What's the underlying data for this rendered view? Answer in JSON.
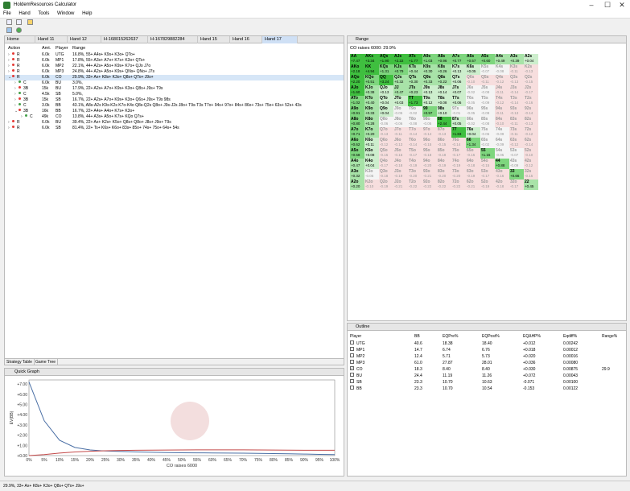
{
  "window": {
    "title": "HoldemResources Calculator"
  },
  "menu": [
    "File",
    "Hand",
    "Tools",
    "Window",
    "Help"
  ],
  "tabs": [
    "Home",
    "Hand 11",
    "Hand 12",
    "H-168015262637",
    "H-167829882284",
    "Hand 15",
    "Hand 16",
    "Hand 17"
  ],
  "strategy": {
    "headers": {
      "action": "Action",
      "amt": "Amt.",
      "player": "Player",
      "range": "Range"
    },
    "rows": [
      {
        "indent": 0,
        "expander": "›",
        "act": "R",
        "amt": "6.0k",
        "player": "UTG",
        "range": "16.8%, 55+ A4s+ K9s+ K3o+ QTo+",
        "color": "#e53935",
        "sel": false
      },
      {
        "indent": 0,
        "expander": "›",
        "act": "R",
        "amt": "6.0k",
        "player": "MP1",
        "range": "17.8%, 55+ A3s+ A7o+ K7s+ K3o+ QTs+",
        "color": "#e53935",
        "sel": false
      },
      {
        "indent": 0,
        "expander": "›",
        "act": "R",
        "amt": "6.0k",
        "player": "MP2",
        "range": "22.1%, 44+ A2s+ A5o+ K9s+ K7o+ QJo J7o",
        "color": "#e53935",
        "sel": false
      },
      {
        "indent": 0,
        "expander": "›",
        "act": "R",
        "amt": "6.0k",
        "player": "MP3",
        "range": "24.8%, 44+ A2s+ A5o+ K9s+ QNs+ QNo+ J7s",
        "color": "#e53935",
        "sel": false
      },
      {
        "indent": 0,
        "expander": "⌄",
        "act": "R",
        "amt": "6.0k",
        "player": "CO",
        "range": "29.9%, 33+ Ax+ K8s+ K3o+ Q8s+ QTo+ J9s+",
        "color": "#e53935",
        "sel": true
      },
      {
        "indent": 1,
        "expander": "›",
        "act": "C",
        "amt": "6.0k",
        "player": "BU",
        "range": "3.0%,",
        "color": "#43a047",
        "sel": false
      },
      {
        "indent": 1,
        "expander": "›",
        "act": "3B",
        "amt": "15k",
        "player": "BU",
        "range": "17.9%, 22+ A2s+ A7o+ K9s+ K3o+ Q8s+ J9s+ T9s",
        "color": "#e53935",
        "sel": false
      },
      {
        "indent": 1,
        "expander": "›",
        "act": "C",
        "amt": "4.5k",
        "player": "SB",
        "range": "5.0%,",
        "color": "#43a047",
        "sel": false
      },
      {
        "indent": 1,
        "expander": "›",
        "act": "3B",
        "amt": "15k",
        "player": "SB",
        "range": "16.7%, 22+ A2s+ A7o+ K9s+ K3o+ Q6s+ J9s+ T9s 98s",
        "color": "#e53935",
        "sel": false
      },
      {
        "indent": 1,
        "expander": "›",
        "act": "C",
        "amt": "3.0k",
        "player": "BB",
        "range": "43.1%, A8s-A2s K9s-K2s K7o-K4o Q8s-Q2s Q8o+ J9s-J2s J8o+ T9s-T3s T7o+ 94s+ 97o+ 84s+ 86o+ 73s+ 75o+ 63s+ 52s+ 43s",
        "color": "#43a047",
        "sel": false
      },
      {
        "indent": 1,
        "expander": "⌄",
        "act": "3B",
        "amt": "16k",
        "player": "BB",
        "range": "16.7%, 22+ A4s+ A4o+ K7s+ K3o+",
        "color": "#e53935",
        "sel": false
      },
      {
        "indent": 2,
        "expander": "›",
        "act": "C",
        "amt": "49k",
        "player": "CO",
        "range": "13.8%, 44+ A3s+ A5o+ K7s+ KQo Q7s+",
        "color": "#43a047",
        "sel": false
      },
      {
        "indent": 0,
        "expander": "›",
        "act": "R",
        "amt": "6.0k",
        "player": "BU",
        "range": "39.4%, 22+ Ax+ K2s+ K5o+ Q8s+ Q8o+ J8s+ J9o+ T9s",
        "color": "#e53935",
        "sel": false
      },
      {
        "indent": 0,
        "expander": "›",
        "act": "R",
        "amt": "6.0k",
        "player": "SB",
        "range": "81.4%, 22+ Ts+ K6s+ K6o+ 83s+ 85o+ 74s+ 75o+ 64s+ 54s",
        "color": "#e53935",
        "sel": false
      }
    ],
    "bottom_tabs": [
      "Strategy Table",
      "Game Tree"
    ]
  },
  "quick_graph": {
    "title": "Quick Graph",
    "xlabel": "CO raises 6000",
    "ylabel": "EV(BB)"
  },
  "chart_data": {
    "type": "line",
    "title": "",
    "xlabel": "CO raises 6000",
    "ylabel": "EV(BB)",
    "x": [
      0,
      5,
      10,
      15,
      20,
      25,
      30,
      35,
      40,
      45,
      50,
      55,
      60,
      65,
      70,
      75,
      80,
      85,
      90,
      95,
      100
    ],
    "x_tick_labels": [
      "0%",
      "5%",
      "10%",
      "15%",
      "20%",
      "25%",
      "30%",
      "35%",
      "40%",
      "45%",
      "50%",
      "55%",
      "60%",
      "65%",
      "70%",
      "75%",
      "80%",
      "85%",
      "90%",
      "95%",
      "100%"
    ],
    "y_tick_labels": [
      "+7.00",
      "+6.00",
      "+5.00",
      "+4.00",
      "+3.00",
      "+2.00",
      "+1.00",
      "+0.00"
    ],
    "ylim": [
      0,
      7.4
    ],
    "series": [
      {
        "color": "#4a6fa5",
        "values": [
          7.2,
          3.4,
          1.5,
          0.8,
          0.55,
          0.45,
          0.4,
          0.35,
          0.32,
          0.3,
          0.28,
          0.27,
          0.26,
          0.25,
          0.24,
          0.22,
          0.2,
          0.18,
          0.15,
          0.12,
          0.1
        ]
      },
      {
        "color": "#c44a4a",
        "values": [
          0.0,
          0.1,
          0.25,
          0.35,
          0.42,
          0.47,
          0.5,
          0.52,
          0.53,
          0.54,
          0.55,
          0.56,
          0.56,
          0.56,
          0.56,
          0.55,
          0.54,
          0.53,
          0.52,
          0.52,
          0.52
        ]
      }
    ]
  },
  "range": {
    "title": "Range",
    "subtitle": "CO raises 6000: 29.9%",
    "ranks": [
      "A",
      "K",
      "Q",
      "J",
      "T",
      "9",
      "8",
      "7",
      "6",
      "5",
      "4",
      "3",
      "2"
    ],
    "cells": [
      [
        "+7.47",
        "+3.34",
        "+1.90",
        "+2.22",
        "+1.77",
        "+1.03",
        "+0.96",
        "+0.77",
        "+0.57",
        "+0.60",
        "+0.49",
        "+0.39",
        "+0.04"
      ],
      [
        "+2.18",
        "+4.94",
        "+1.31",
        "+0.79",
        "+0.44",
        "+0.30",
        "+0.26",
        "+0.13",
        "+0.05",
        "-0.07",
        "-0.08",
        "-0.11",
        "-0.13"
      ],
      [
        "+2.20",
        "+0.51",
        "+3.24",
        "+0.32",
        "+0.30",
        "+0.33",
        "+0.22",
        "+0.06",
        "-0.10",
        "-0.11",
        "-0.12",
        "-0.13",
        "-0.15"
      ],
      [
        "+1.60",
        "+0.38",
        "+0.13",
        "+0.47",
        "+0.23",
        "+0.13",
        "+0.14",
        "+0.07",
        "-0.02",
        "-0.08",
        "-0.11",
        "-0.14",
        "-0.17"
      ],
      [
        "+1.02",
        "+0.40",
        "+0.04",
        "+0.03",
        "+1.73",
        "+0.12",
        "+0.08",
        "+0.06",
        "-0.05",
        "-0.09",
        "-0.12",
        "-0.14",
        "-0.16"
      ],
      [
        "+0.91",
        "+0.33",
        "+0.04",
        "-0.05",
        "-0.02",
        "+0.97",
        "+0.10",
        "-0.01",
        "-0.05",
        "-0.09",
        "-0.11",
        "-0.13",
        "-0.14"
      ],
      [
        "+0.80",
        "+0.28",
        "-0.06",
        "-0.06",
        "-0.08",
        "-0.05",
        "+2.44",
        "+0.05",
        "-0.02",
        "-0.08",
        "-0.10",
        "-0.11",
        "-0.13"
      ],
      [
        "+0.71",
        "+0.20",
        "-0.13",
        "-0.11",
        "-0.14",
        "-0.14",
        "-0.13",
        "+1.83",
        "+0.04",
        "-0.06",
        "-0.09",
        "-0.11",
        "-0.12"
      ],
      [
        "+0.62",
        "+0.11",
        "-0.12",
        "-0.13",
        "-0.14",
        "-0.15",
        "-0.15",
        "-0.14",
        "+1.34",
        "-0.02",
        "-0.09",
        "-0.12",
        "-0.14"
      ],
      [
        "+0.58",
        "+0.08",
        "-0.15",
        "-0.16",
        "-0.17",
        "-0.18",
        "-0.18",
        "-0.17",
        "-0.15",
        "+1.15",
        "-0.05",
        "-0.07",
        "-0.10"
      ],
      [
        "+0.47",
        "+0.04",
        "-0.17",
        "-0.18",
        "-0.19",
        "-0.20",
        "-0.19",
        "-0.19",
        "-0.18",
        "-0.15",
        "+0.88",
        "-0.09",
        "-0.12"
      ],
      [
        "+0.32",
        "-0.05",
        "-0.18",
        "-0.19",
        "-0.20",
        "-0.21",
        "-0.20",
        "-0.20",
        "-0.19",
        "-0.17",
        "-0.16",
        "+0.66",
        "-0.15"
      ],
      [
        "+0.20",
        "-0.10",
        "-0.19",
        "-0.21",
        "-0.22",
        "-0.22",
        "-0.22",
        "-0.22",
        "-0.21",
        "-0.19",
        "-0.18",
        "-0.17",
        "+0.45"
      ]
    ]
  },
  "outline": {
    "title": "Outline",
    "headers": {
      "player": "Player",
      "bb": "BB",
      "eqpre": "EQPre%",
      "eqpost": "EQPost%",
      "eqdiff": "EQΔHP%",
      "eqdiffhand": "Eqdiff%",
      "range": "Range%"
    },
    "rows": [
      {
        "player": "UTG",
        "checked": false,
        "bb": "40.6",
        "eqpre": "18.38",
        "eqpost": "18.40",
        "eqdiff": "+0.012",
        "eqdiffhand": "0.00242",
        "range": ""
      },
      {
        "player": "MP1",
        "checked": false,
        "bb": "14.7",
        "eqpre": "6.74",
        "eqpost": "6.76",
        "eqdiff": "+0.018",
        "eqdiffhand": "0.00012",
        "range": ""
      },
      {
        "player": "MP2",
        "checked": false,
        "bb": "12.4",
        "eqpre": "5.71",
        "eqpost": "5.73",
        "eqdiff": "+0.020",
        "eqdiffhand": "0.00016",
        "range": ""
      },
      {
        "player": "MP3",
        "checked": false,
        "bb": "61.0",
        "eqpre": "27.87",
        "eqpost": "28.01",
        "eqdiff": "+0.036",
        "eqdiffhand": "0.00080",
        "range": ""
      },
      {
        "player": "CO",
        "checked": true,
        "bb": "18.3",
        "eqpre": "8.40",
        "eqpost": "8.40",
        "eqdiff": "+0.030",
        "eqdiffhand": "0.00875",
        "range": "29.9"
      },
      {
        "player": "BU",
        "checked": false,
        "bb": "24.4",
        "eqpre": "11.19",
        "eqpost": "11.26",
        "eqdiff": "+0.072",
        "eqdiffhand": "0.00043",
        "range": ""
      },
      {
        "player": "SB",
        "checked": false,
        "bb": "23.3",
        "eqpre": "10.70",
        "eqpost": "10.63",
        "eqdiff": "-0.071",
        "eqdiffhand": "0.00100",
        "range": ""
      },
      {
        "player": "BB",
        "checked": false,
        "bb": "23.3",
        "eqpre": "10.70",
        "eqpost": "10.54",
        "eqdiff": "-0.153",
        "eqdiffhand": "0.00122",
        "range": ""
      }
    ]
  },
  "statusbar": {
    "text": "29.9%, 33+ Ax+ K8s+ K3o+ Q8s+ QTo+ J9s+"
  }
}
